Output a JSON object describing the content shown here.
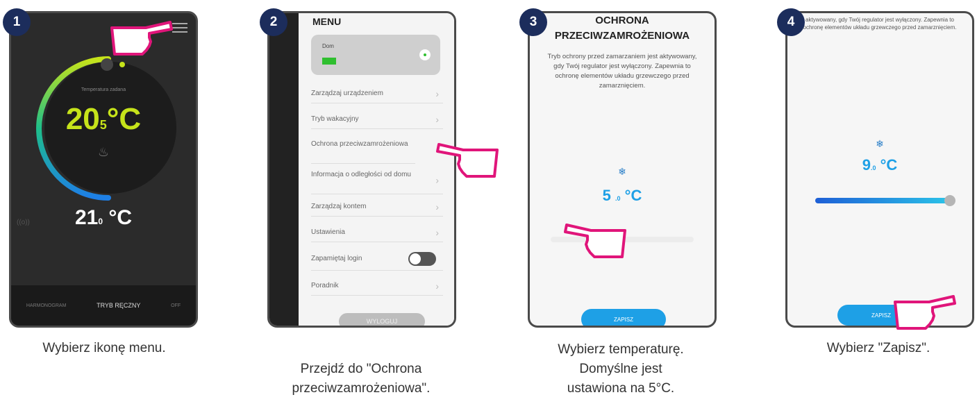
{
  "steps": [
    {
      "number": "1",
      "caption_lines": [
        "Wybierz ikonę menu."
      ],
      "screen": {
        "setpoint_label": "Temperatura zadana",
        "setpoint_int": "20",
        "setpoint_dec": "5",
        "unit": "°C",
        "current_int": "21",
        "current_dec": "0",
        "tabs": [
          "HARMONOGRAM",
          "TRYB RĘCZNY",
          "OFF"
        ]
      }
    },
    {
      "number": "2",
      "caption_lines": [
        "Przejdź do \"Ochrona",
        "przeciwzamrożeniowa\"."
      ],
      "screen": {
        "title": "MENU",
        "home_label": "Dom",
        "items": [
          "Zarządzaj urządzeniem",
          "Tryb wakacyjny",
          "Ochrona przeciwzamrożeniowa",
          "Informacja o odległości od domu",
          "Zarządzaj kontem",
          "Ustawienia",
          "Zapamiętaj login",
          "Poradnik"
        ],
        "logout": "WYLOGUJ"
      }
    },
    {
      "number": "3",
      "caption_lines": [
        "Wybierz temperaturę.",
        "Domyślne jest",
        "ustawiona na 5°C."
      ],
      "screen": {
        "title_line1": "OCHRONA",
        "title_line2": "PRZECIWZAMROŻENIOWA",
        "description": "Tryb ochrony przed zamarzaniem jest aktywowany, gdy Twój regulator jest wyłączony. Zapewnia to ochronę elementów układu grzewczego przed zamarznięciem.",
        "value_int": "5",
        "value_dec": ".0",
        "unit": "°C",
        "save": "ZAPISZ"
      }
    },
    {
      "number": "4",
      "caption_lines": [
        "Wybierz \"Zapisz\"."
      ],
      "screen": {
        "description": "aktywowany, gdy Twój regulator jest wyłączony. Zapewnia to ochronę elementów układu grzewczego przed zamarznięciem.",
        "value_int": "9",
        "value_dec": ".0",
        "unit": "°C",
        "save": "ZAPISZ"
      }
    }
  ],
  "colors": {
    "badge": "#1c2d5c",
    "hand": "#e0157a",
    "accent_blue": "#1ea0e6",
    "lime": "#c6e31a"
  }
}
